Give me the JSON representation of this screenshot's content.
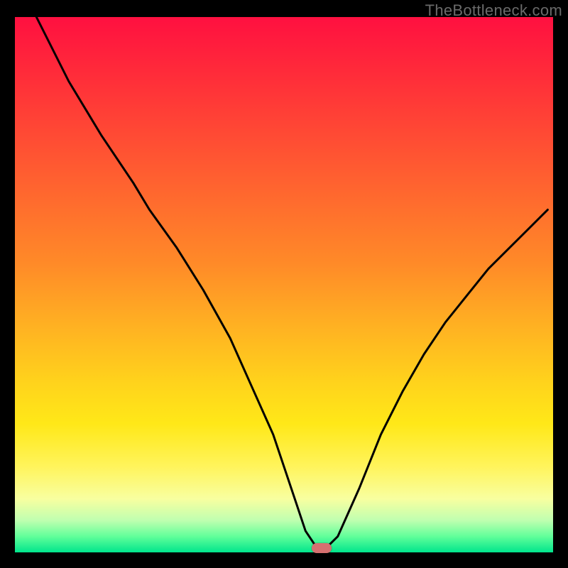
{
  "watermark": "TheBottleneck.com",
  "colors": {
    "frame": "#000000",
    "curve": "#000000",
    "marker": "#d67070",
    "gradient_top": "#ff1040",
    "gradient_bottom": "#00e58c"
  },
  "chart_data": {
    "type": "line",
    "title": "",
    "xlabel": "",
    "ylabel": "",
    "xlim": [
      0,
      100
    ],
    "ylim": [
      0,
      100
    ],
    "axes_visible": false,
    "grid": false,
    "background": "vertical-heat-gradient",
    "series": [
      {
        "name": "bottleneck-curve",
        "x": [
          4,
          10,
          16,
          22,
          25,
          30,
          35,
          40,
          44,
          48,
          52,
          54,
          56,
          58,
          60,
          64,
          68,
          72,
          76,
          80,
          84,
          88,
          92,
          96,
          99
        ],
        "y": [
          100,
          88,
          78,
          69,
          64,
          57,
          49,
          40,
          31,
          22,
          10,
          4,
          1,
          1,
          3,
          12,
          22,
          30,
          37,
          43,
          48,
          53,
          57,
          61,
          64
        ]
      }
    ],
    "marker": {
      "x": 57,
      "y": 0.5,
      "shape": "rounded-rect",
      "color": "#d67070"
    },
    "legend": false
  }
}
